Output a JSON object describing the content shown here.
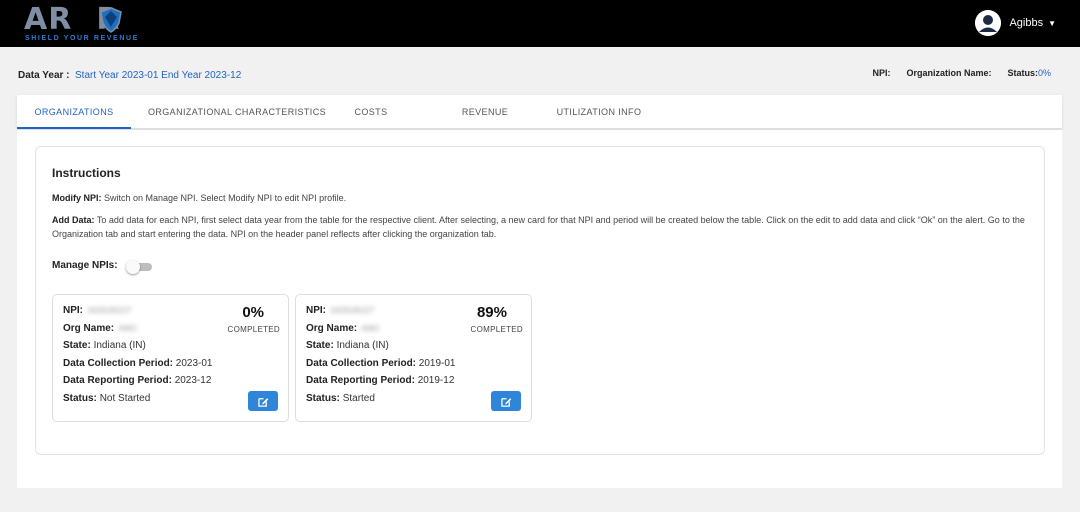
{
  "header": {
    "logo_text": "ARMOR",
    "logo_tagline": "SHIELD YOUR REVENUE",
    "user_name": "Agibbs"
  },
  "info": {
    "data_year_label": "Data Year :",
    "data_year_value": "Start Year 2023-01 End Year 2023-12",
    "npi_label": "NPI:",
    "org_name_label": "Organization Name:",
    "status_label": "Status:",
    "status_value": "0%"
  },
  "tabs": [
    {
      "label": "ORGANIZATIONS",
      "active": true
    },
    {
      "label": "ORGANIZATIONAL CHARACTERISTICS",
      "active": false
    },
    {
      "label": "COSTS",
      "active": false
    },
    {
      "label": "REVENUE",
      "active": false
    },
    {
      "label": "UTILIZATION INFO",
      "active": false
    }
  ],
  "instructions": {
    "title": "Instructions",
    "modify_label": "Modify NPI:",
    "modify_text": " Switch on Manage NPI. Select Modify NPI to edit NPI profile.",
    "add_label": "Add Data:",
    "add_text": " To add data for each NPI, first select data year from the table for the respective client. After selecting, a new card for that NPI and period will be created below the table. Click on the edit to add data and click “Ok” on the alert. Go to the Organization tab and start entering the data. NPI on the header panel reflects after clicking the organization tab.",
    "manage_label": "Manage NPIs:",
    "manage_on": false
  },
  "cards": [
    {
      "npi_label": "NPI:",
      "npi_value": "1629195227",
      "org_label": "Org Name:",
      "org_value": "AMO",
      "state_label": "State:",
      "state_value": "Indiana (IN)",
      "collection_label": "Data Collection Period:",
      "collection_value": "2023-01",
      "reporting_label": "Data Reporting Period:",
      "reporting_value": "2023-12",
      "status_label": "Status:",
      "status_value": "Not Started",
      "percent": "0%",
      "percent_label": "COMPLETED"
    },
    {
      "npi_label": "NPI:",
      "npi_value": "1629195227",
      "org_label": "Org Name:",
      "org_value": "AMO",
      "state_label": "State:",
      "state_value": "Indiana (IN)",
      "collection_label": "Data Collection Period:",
      "collection_value": "2019-01",
      "reporting_label": "Data Reporting Period:",
      "reporting_value": "2019-12",
      "status_label": "Status:",
      "status_value": "Started",
      "percent": "89%",
      "percent_label": "COMPLETED"
    }
  ],
  "colors": {
    "accent": "#1f63c6",
    "button": "#2f86d8",
    "topbar": "#000000"
  },
  "icons": {
    "user": "user-avatar-icon",
    "caret": "caret-down-icon",
    "edit": "edit-icon",
    "logo": "shield-icon"
  }
}
